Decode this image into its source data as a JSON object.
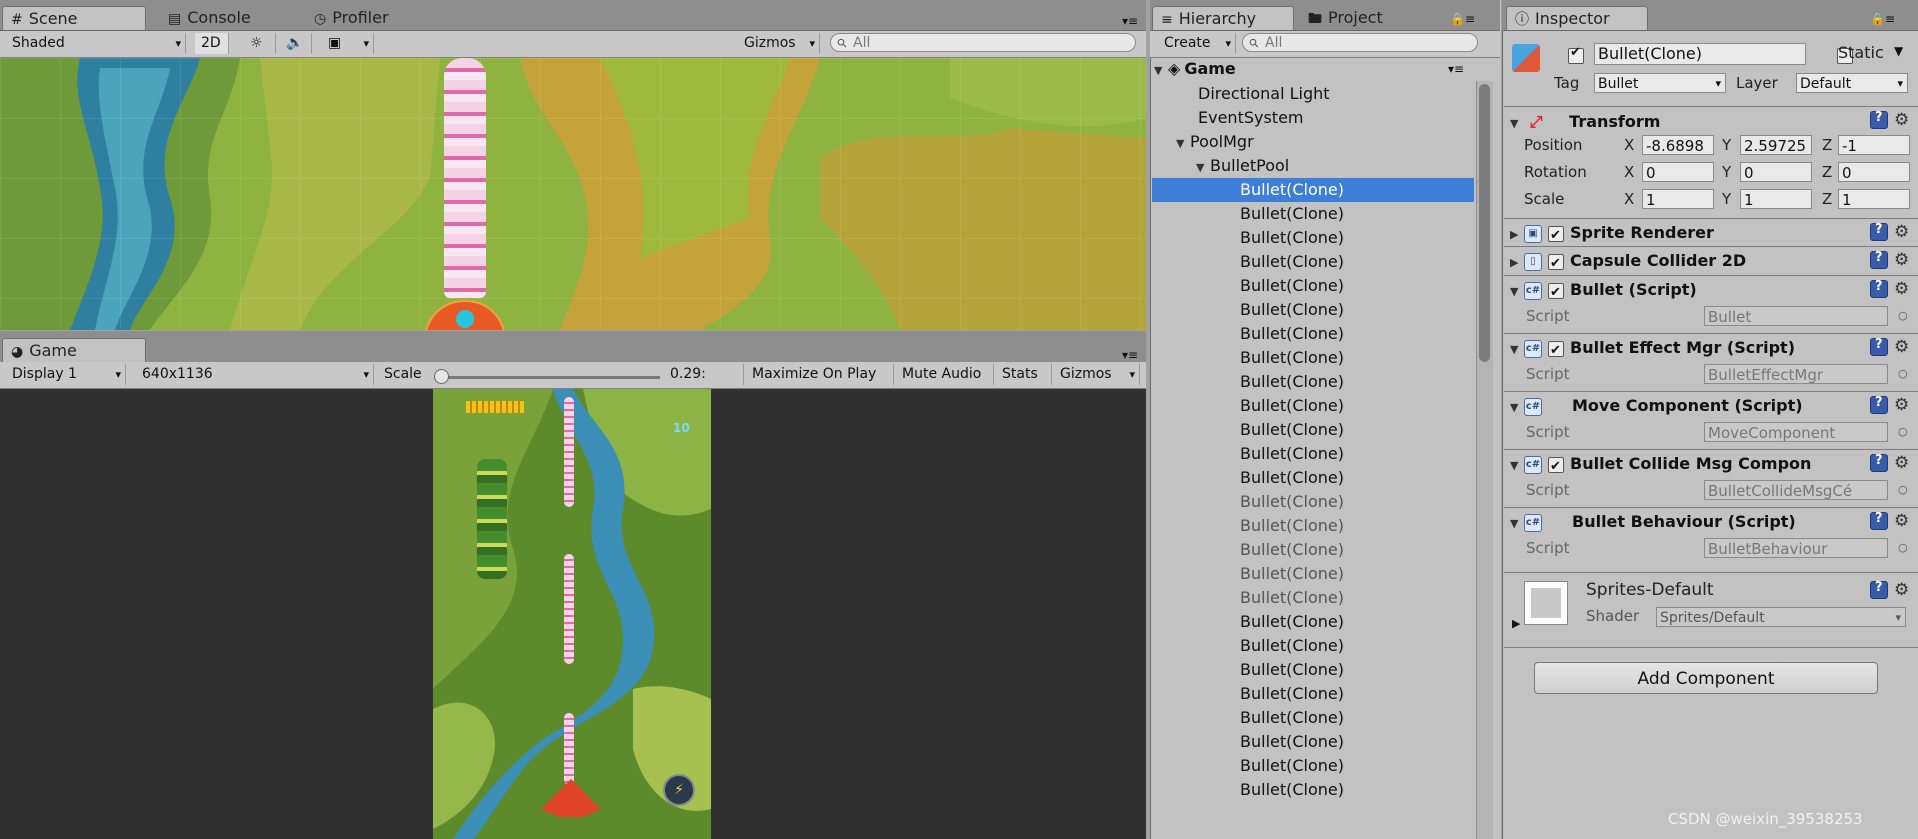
{
  "scene_panel": {
    "tabs": [
      {
        "label": "Scene",
        "icon": "grid-icon"
      },
      {
        "label": "Console",
        "icon": "console-icon"
      },
      {
        "label": "Profiler",
        "icon": "profiler-icon"
      }
    ],
    "toolbar": {
      "shading": "Shaded",
      "mode_2d": "2D",
      "gizmos": "Gizmos",
      "search_placeholder": "All"
    }
  },
  "game_panel": {
    "tab": "Game",
    "display": "Display 1",
    "resolution": "640x1136",
    "scale_label": "Scale",
    "scale_value": "0.29:",
    "maximize": "Maximize On Play",
    "mute": "Mute Audio",
    "stats": "Stats",
    "gizmos": "Gizmos",
    "hud_score": "10"
  },
  "hierarchy": {
    "tabs": [
      "Hierarchy",
      "Project"
    ],
    "create": "Create",
    "search_placeholder": "All",
    "scene_name": "Game",
    "rows": [
      {
        "label": "Directional Light",
        "indent": 1,
        "state": "normal"
      },
      {
        "label": "EventSystem",
        "indent": 1,
        "state": "normal"
      },
      {
        "label": "PoolMgr",
        "indent": 1,
        "state": "normal",
        "expanded": true
      },
      {
        "label": "BulletPool",
        "indent": 2,
        "state": "normal",
        "expanded": true
      },
      {
        "label": "Bullet(Clone)",
        "indent": 3,
        "state": "selected"
      },
      {
        "label": "Bullet(Clone)",
        "indent": 3,
        "state": "normal"
      },
      {
        "label": "Bullet(Clone)",
        "indent": 3,
        "state": "normal"
      },
      {
        "label": "Bullet(Clone)",
        "indent": 3,
        "state": "normal"
      },
      {
        "label": "Bullet(Clone)",
        "indent": 3,
        "state": "normal"
      },
      {
        "label": "Bullet(Clone)",
        "indent": 3,
        "state": "normal"
      },
      {
        "label": "Bullet(Clone)",
        "indent": 3,
        "state": "normal"
      },
      {
        "label": "Bullet(Clone)",
        "indent": 3,
        "state": "normal"
      },
      {
        "label": "Bullet(Clone)",
        "indent": 3,
        "state": "normal"
      },
      {
        "label": "Bullet(Clone)",
        "indent": 3,
        "state": "normal"
      },
      {
        "label": "Bullet(Clone)",
        "indent": 3,
        "state": "normal"
      },
      {
        "label": "Bullet(Clone)",
        "indent": 3,
        "state": "normal"
      },
      {
        "label": "Bullet(Clone)",
        "indent": 3,
        "state": "normal"
      },
      {
        "label": "Bullet(Clone)",
        "indent": 3,
        "state": "dim"
      },
      {
        "label": "Bullet(Clone)",
        "indent": 3,
        "state": "dim"
      },
      {
        "label": "Bullet(Clone)",
        "indent": 3,
        "state": "dim"
      },
      {
        "label": "Bullet(Clone)",
        "indent": 3,
        "state": "dim"
      },
      {
        "label": "Bullet(Clone)",
        "indent": 3,
        "state": "dim"
      },
      {
        "label": "Bullet(Clone)",
        "indent": 3,
        "state": "normal"
      },
      {
        "label": "Bullet(Clone)",
        "indent": 3,
        "state": "normal"
      },
      {
        "label": "Bullet(Clone)",
        "indent": 3,
        "state": "normal"
      },
      {
        "label": "Bullet(Clone)",
        "indent": 3,
        "state": "normal"
      },
      {
        "label": "Bullet(Clone)",
        "indent": 3,
        "state": "normal"
      },
      {
        "label": "Bullet(Clone)",
        "indent": 3,
        "state": "normal"
      },
      {
        "label": "Bullet(Clone)",
        "indent": 3,
        "state": "normal"
      },
      {
        "label": "Bullet(Clone)",
        "indent": 3,
        "state": "normal"
      }
    ]
  },
  "inspector": {
    "tab": "Inspector",
    "object_name": "Bullet(Clone)",
    "static_label": "Static",
    "tag_label": "Tag",
    "tag_value": "Bullet",
    "layer_label": "Layer",
    "layer_value": "Default",
    "transform": {
      "title": "Transform",
      "position": {
        "label": "Position",
        "x": "-8.6898",
        "y": "2.59725",
        "z": "-1"
      },
      "rotation": {
        "label": "Rotation",
        "x": "0",
        "y": "0",
        "z": "0"
      },
      "scale": {
        "label": "Scale",
        "x": "1",
        "y": "1",
        "z": "1"
      }
    },
    "components": [
      {
        "title": "Sprite Renderer",
        "checked": true,
        "collapsed": true,
        "icon": "sprite-renderer-icon"
      },
      {
        "title": "Capsule Collider 2D",
        "checked": true,
        "collapsed": true,
        "icon": "capsule-collider-icon"
      },
      {
        "title": "Bullet (Script)",
        "checked": true,
        "script": "Bullet"
      },
      {
        "title": "Bullet Effect Mgr (Script)",
        "checked": true,
        "script": "BulletEffectMgr"
      },
      {
        "title": "Move Component (Script)",
        "checked": false,
        "script": "MoveComponent"
      },
      {
        "title": "Bullet Collide Msg Compon",
        "checked": true,
        "script": "BulletCollideMsgCé"
      },
      {
        "title": "Bullet Behaviour (Script)",
        "checked": false,
        "script": "BulletBehaviour"
      }
    ],
    "script_label": "Script",
    "material": {
      "name": "Sprites-Default",
      "shader_label": "Shader",
      "shader_value": "Sprites/Default"
    },
    "add_component": "Add Component"
  },
  "watermark": "CSDN @weixin_39538253",
  "colors": {
    "selection": "#3e7ed8",
    "panel": "#c2c2c2",
    "game_bg": "#313131"
  }
}
